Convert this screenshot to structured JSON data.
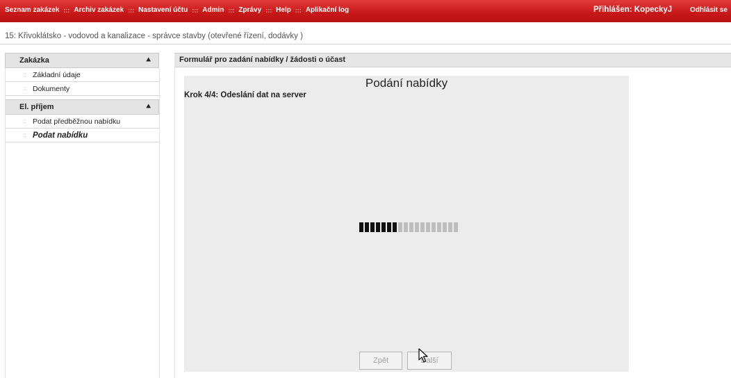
{
  "topnav": {
    "items": [
      "Seznam zakázek",
      "Archiv zakázek",
      "Nastavení účtu",
      "Admin",
      "Zprávy",
      "Help",
      "Aplikační log"
    ],
    "separator": ":::",
    "login": "Přihlášen: KopeckyJ",
    "logout": "Odhlásit se"
  },
  "project": {
    "title": "15: Křivoklátsko - vodovod a kanalizace - správce stavby (otevřené řízení, dodávky )"
  },
  "sidebar": {
    "sections": [
      {
        "title": "Zakázka",
        "items": [
          {
            "label": "Základní údaje"
          },
          {
            "label": "Dokumenty"
          }
        ]
      },
      {
        "title": "El. příjem",
        "items": [
          {
            "label": "Podat předběžnou nabídku"
          },
          {
            "label": "Podat nabídku"
          }
        ]
      }
    ],
    "bullet": "::",
    "collapse_icon": "double-chevron-up-icon"
  },
  "panel": {
    "header": "Formulář pro zadání nabídky / žádosti o účast",
    "wizard_title": "Podání nabídky",
    "step": "Krok 4/4: Odeslání dat na server",
    "progress": {
      "segments_total": 18,
      "segments_done": 7
    },
    "buttons": {
      "back": "Zpět",
      "next": "Další"
    }
  },
  "colors": {
    "topbar": "#c71818",
    "panel_bg": "#ececec",
    "progress_done": "#111111",
    "progress_todo": "#bdbdbd"
  }
}
